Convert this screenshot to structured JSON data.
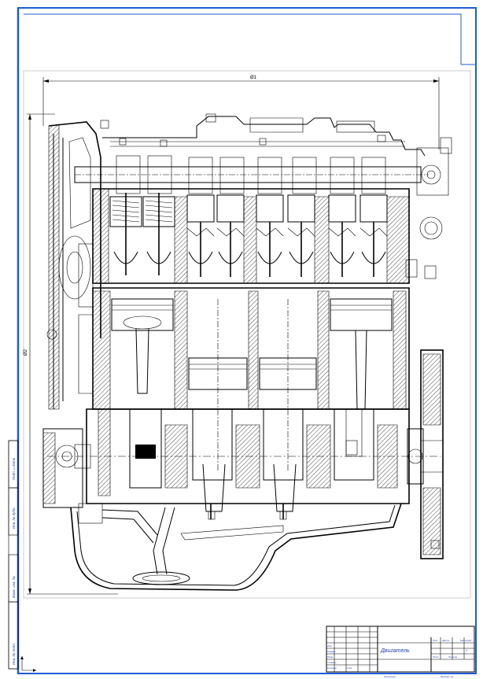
{
  "drawing": {
    "title": "Двигатель",
    "dimension_width": "Ø1",
    "dimension_height": "Ø2"
  },
  "side_strip": {
    "label_top": "Подп. и дата",
    "label_mid": "Инв. № дубл.",
    "label_low": "Взам. инв. №",
    "label_bottom": "Инв. № подл."
  },
  "title_block": {
    "rows": [
      "Изм.",
      "Разраб.",
      "Пров.",
      "Т.контр.",
      "Н.контр.",
      "Утв."
    ],
    "sheet_label": "Лист",
    "sheets_label": "Листов",
    "letter_label": "Лит.",
    "mass_label": "Масса",
    "scale_label": "Масштаб",
    "sheet_value": "1",
    "copied": "Копировал",
    "format": "Формат А1"
  },
  "colors": {
    "frame": "#1e5bd6",
    "ink": "#000000"
  }
}
